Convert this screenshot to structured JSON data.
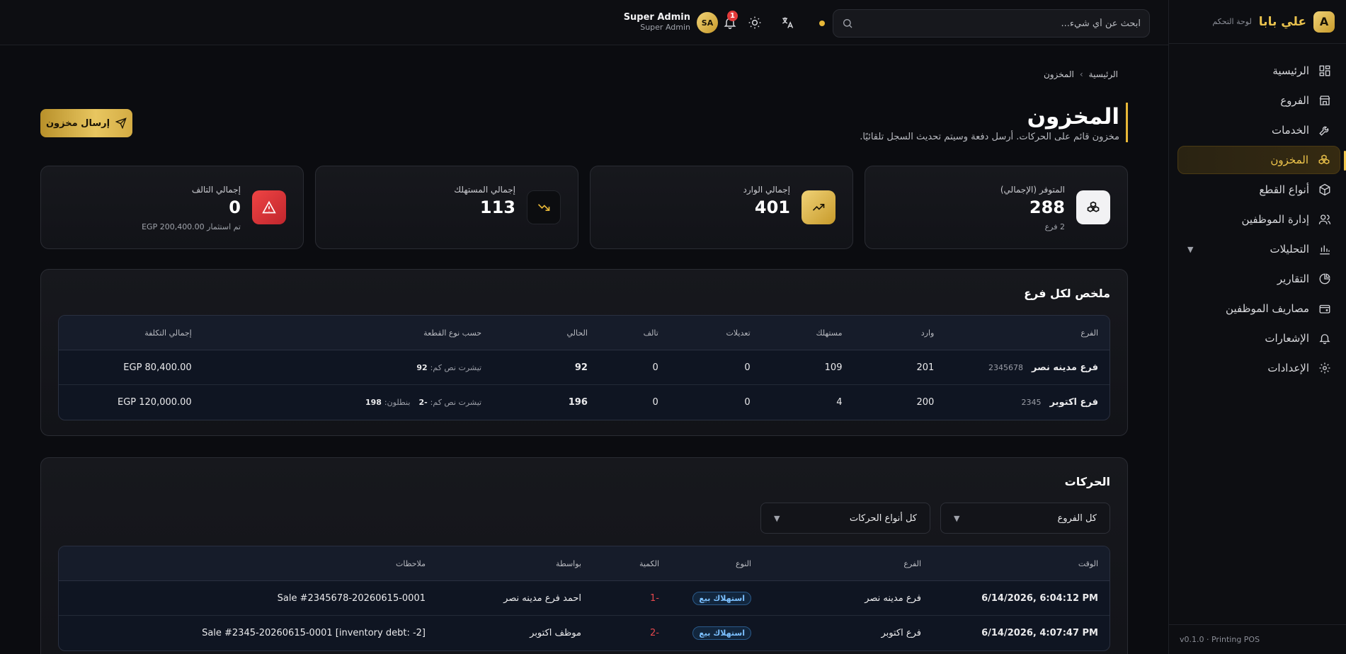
{
  "brand": {
    "logo_letter": "A",
    "name": "علي بابا",
    "subtitle": "لوحة التحكم"
  },
  "sidebar": {
    "items": [
      {
        "label": "الرئيسية",
        "icon": "dashboard-icon"
      },
      {
        "label": "الفروع",
        "icon": "store-icon"
      },
      {
        "label": "الخدمات",
        "icon": "wrench-icon"
      },
      {
        "label": "المخزون",
        "icon": "boxes-icon",
        "active": true
      },
      {
        "label": "أنواع القطع",
        "icon": "package-icon"
      },
      {
        "label": "إدارة الموظفين",
        "icon": "users-icon"
      },
      {
        "label": "التحليلات",
        "icon": "bar-chart-icon",
        "expandable": true
      },
      {
        "label": "التقارير",
        "icon": "pie-chart-icon"
      },
      {
        "label": "مصاريف الموظفين",
        "icon": "wallet-icon"
      },
      {
        "label": "الإشعارات",
        "icon": "bell-icon"
      },
      {
        "label": "الإعدادات",
        "icon": "gear-icon"
      }
    ],
    "version": "v0.1.0 · Printing POS"
  },
  "topbar": {
    "search_placeholder": "ابحث عن أي شيء...",
    "notification_count": "1",
    "user_initials": "SA",
    "user_name": "Super Admin",
    "user_role": "Super Admin"
  },
  "breadcrumb": {
    "home": "الرئيسية",
    "current": "المخزون"
  },
  "page": {
    "title": "المخزون",
    "subtitle": "مخزون قائم على الحركات. أرسل دفعة وسيتم تحديث السجل تلقائيًا.",
    "send_button": "إرسال مخزون"
  },
  "stats": [
    {
      "label": "المتوفر (الإجمالي)",
      "value": "288",
      "foot": "2 فرع",
      "icon": "boxes-icon"
    },
    {
      "label": "إجمالي الوارد",
      "value": "401",
      "foot": "",
      "icon": "trending-up-icon"
    },
    {
      "label": "إجمالي المستهلك",
      "value": "113",
      "foot": "",
      "icon": "trending-down-icon"
    },
    {
      "label": "إجمالي التالف",
      "value": "0",
      "foot": "تم استثمار EGP 200,400.00",
      "icon": "warning-icon"
    }
  ],
  "colors": {
    "accent": "#e8b838",
    "danger": "#e23b3b",
    "background": "#0b0c10"
  },
  "summary": {
    "title": "ملخص لكل فرع",
    "headers": [
      "الفرع",
      "وارد",
      "مستهلك",
      "تعديلات",
      "تالف",
      "الحالي",
      "حسب نوع القطعة",
      "إجمالي التكلفة"
    ],
    "rows": [
      {
        "branch": "فرع مدينه نصر",
        "code": "2345678",
        "in": "201",
        "consumed": "109",
        "adjust": "0",
        "damaged": "0",
        "current": "92",
        "by_type": [
          {
            "name": "تيشرت نص كم:",
            "qty": "92"
          }
        ],
        "cost": "EGP 80,400.00"
      },
      {
        "branch": "فرع اكتوبر",
        "code": "2345",
        "in": "200",
        "consumed": "4",
        "adjust": "0",
        "damaged": "0",
        "current": "196",
        "by_type": [
          {
            "name": "تيشرت نص كم:",
            "qty": "-2"
          },
          {
            "name": "بنطلون:",
            "qty": "198"
          }
        ],
        "cost": "EGP 120,000.00"
      }
    ]
  },
  "movements": {
    "title": "الحركات",
    "filter_branch": "كل الفروع",
    "filter_type": "كل أنواع الحركات",
    "headers": [
      "الوقت",
      "الفرع",
      "النوع",
      "الكمية",
      "بواسطة",
      "ملاحظات"
    ],
    "rows": [
      {
        "time": "6/14/2026, 6:04:12 PM",
        "branch": "فرع مدينه نصر",
        "type": "استهلاك بيع",
        "qty": "-1",
        "by": "احمد فرع مدينه نصر",
        "notes": "Sale #2345678-20260615-0001"
      },
      {
        "time": "6/14/2026, 4:07:47 PM",
        "branch": "فرع اكتوبر",
        "type": "استهلاك بيع",
        "qty": "-2",
        "by": "موظف اكتوبر",
        "notes": "Sale #2345-20260615-0001 [inventory debt: -2]"
      }
    ]
  }
}
